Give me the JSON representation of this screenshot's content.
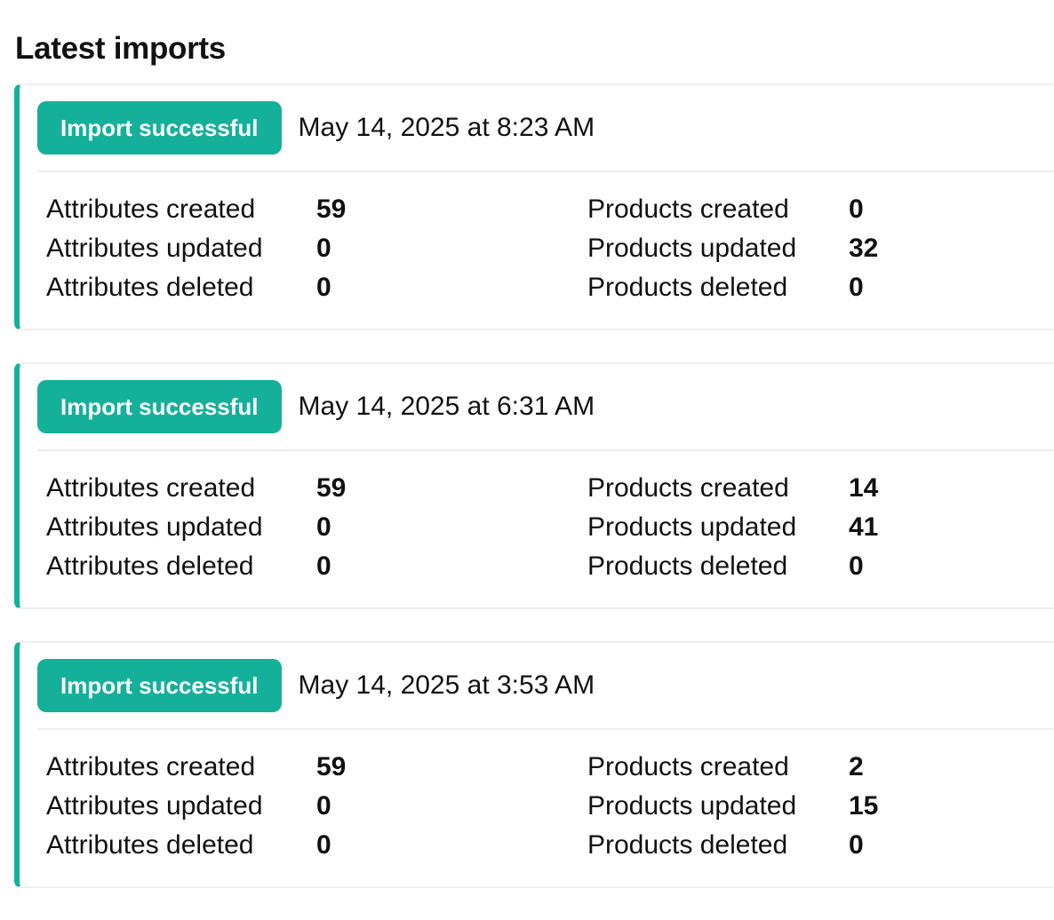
{
  "page": {
    "title": "Latest imports"
  },
  "colors": {
    "accent": "#14b09a",
    "border": "#eeeeee",
    "text": "#111111"
  },
  "imports": [
    {
      "status": "Import successful",
      "timestamp": "May 14, 2025 at 8:23 AM",
      "attributes_created_label": "Attributes created",
      "attributes_created": "59",
      "attributes_updated_label": "Attributes updated",
      "attributes_updated": "0",
      "attributes_deleted_label": "Attributes deleted",
      "attributes_deleted": "0",
      "products_created_label": "Products created",
      "products_created": "0",
      "products_updated_label": "Products updated",
      "products_updated": "32",
      "products_deleted_label": "Products deleted",
      "products_deleted": "0"
    },
    {
      "status": "Import successful",
      "timestamp": "May 14, 2025 at 6:31 AM",
      "attributes_created_label": "Attributes created",
      "attributes_created": "59",
      "attributes_updated_label": "Attributes updated",
      "attributes_updated": "0",
      "attributes_deleted_label": "Attributes deleted",
      "attributes_deleted": "0",
      "products_created_label": "Products created",
      "products_created": "14",
      "products_updated_label": "Products updated",
      "products_updated": "41",
      "products_deleted_label": "Products deleted",
      "products_deleted": "0"
    },
    {
      "status": "Import successful",
      "timestamp": "May 14, 2025 at 3:53 AM",
      "attributes_created_label": "Attributes created",
      "attributes_created": "59",
      "attributes_updated_label": "Attributes updated",
      "attributes_updated": "0",
      "attributes_deleted_label": "Attributes deleted",
      "attributes_deleted": "0",
      "products_created_label": "Products created",
      "products_created": "2",
      "products_updated_label": "Products updated",
      "products_updated": "15",
      "products_deleted_label": "Products deleted",
      "products_deleted": "0"
    }
  ]
}
